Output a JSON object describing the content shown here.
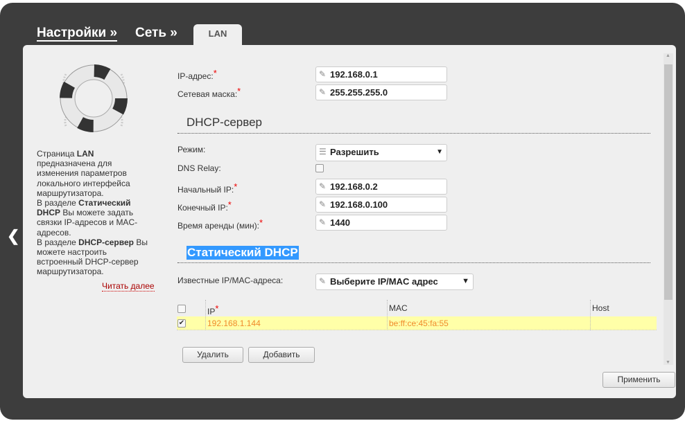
{
  "breadcrumb": {
    "settings": "Настройки »",
    "network": "Сеть »",
    "tab": "LAN"
  },
  "help": {
    "t1": "Страница ",
    "b1": "LAN",
    "t2": " предназначена для изменения параметров локального интерфейса маршрутизатора.",
    "t3": "В разделе ",
    "b2": "Статический DHCP",
    "t4": " Вы можете задать связки IP-адресов и MAC-адресов.",
    "t5": "В разделе ",
    "b3": "DHCP-сервер",
    "t6": " Вы можете настроить встроенный DHCP-сервер маршрутизатора.",
    "read_more": "Читать далее"
  },
  "lan": {
    "ip_label": "IP-адрес:",
    "ip": "192.168.0.1",
    "mask_label": "Сетевая маска:",
    "mask": "255.255.255.0"
  },
  "dhcp": {
    "title": "DHCP-сервер",
    "mode_label": "Режим:",
    "mode": "Разрешить",
    "dns_relay_label": "DNS Relay:",
    "dns_relay": false,
    "start_label": "Начальный IP:",
    "start": "192.168.0.2",
    "end_label": "Конечный IP:",
    "end": "192.168.0.100",
    "lease_label": "Время аренды (мин):",
    "lease": "1440"
  },
  "static": {
    "title": "Статический DHCP",
    "known_label": "Известные IP/MAC-адреса:",
    "known_placeholder": "Выберите IP/MAC адрес",
    "columns": {
      "ip": "IP",
      "mac": "MAC",
      "host": "Host"
    },
    "rows": [
      {
        "checked": true,
        "ip": "192.168.1.144",
        "mac": "be:ff:ce:45:fa:55",
        "host": ""
      }
    ],
    "delete": "Удалить",
    "add": "Добавить"
  },
  "required_mark": "*",
  "apply": "Применить",
  "colors": {
    "frame": "#3d3d3d",
    "panel": "#efefef",
    "row_highlight": "#ffffa8",
    "row_text": "#f08a2a"
  }
}
